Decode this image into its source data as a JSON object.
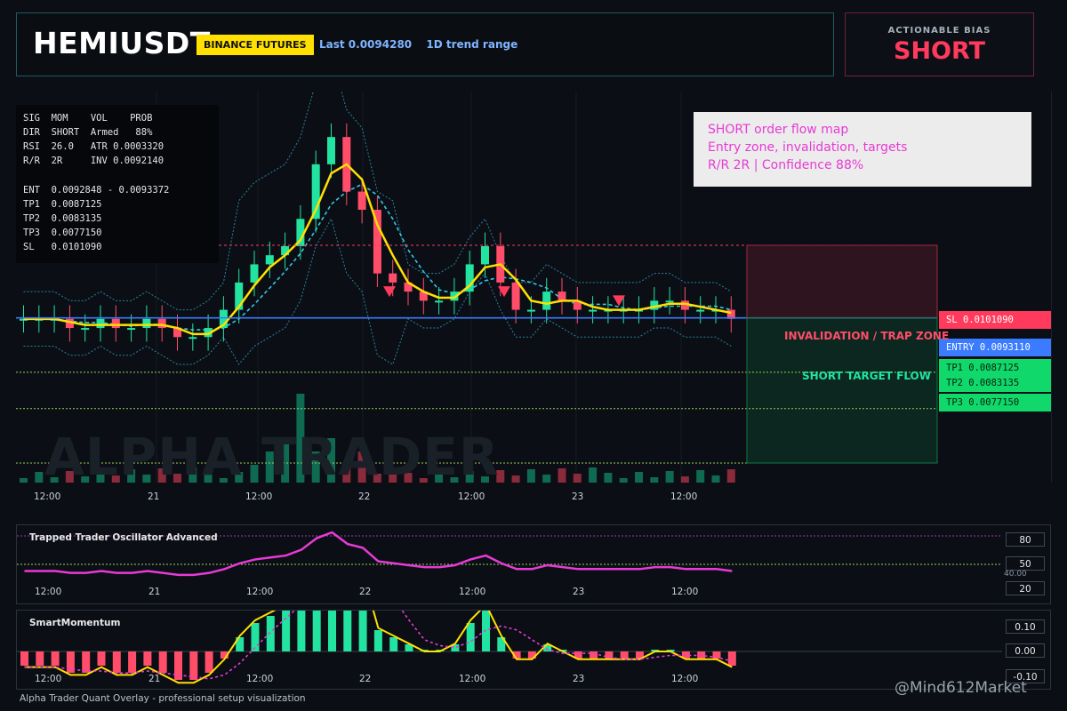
{
  "header": {
    "symbol": "HEMIUSDT",
    "exchange": "BINANCE FUTURES",
    "last_price": "Last 0.0094280",
    "range_label": "1D trend range"
  },
  "bias": {
    "label": "ACTIONABLE BIAS",
    "value": "SHORT",
    "color": "#ff3a5c"
  },
  "signal_table": {
    "rows": [
      "SIG  MOM    VOL    PROB",
      "DIR  SHORT  Armed   88%",
      "RSI  26.0   ATR 0.0003320",
      "R/R  2R     INV 0.0092140",
      "",
      "ENT  0.0092848 - 0.0093372",
      "TP1  0.0087125",
      "TP2  0.0083135",
      "TP3  0.0077150",
      "SL   0.0101090"
    ]
  },
  "info_box": {
    "line1": "SHORT order flow map",
    "line2": "Entry zone, invalidation, targets",
    "line3": "R/R 2R | Confidence 88%"
  },
  "watermark": "ALPHA TRADER",
  "levels": {
    "sl": "SL 0.0101090",
    "entry": "ENTRY 0.0093110",
    "tp1": "TP1 0.0087125",
    "tp2": "TP2 0.0083135",
    "tp3": "TP3 0.0077150",
    "invalidation_label": "INVALIDATION / TRAP ZONE",
    "target_label": "SHORT TARGET FLOW"
  },
  "time_axis": [
    "12:00",
    "21",
    "12:00",
    "22",
    "12:00",
    "23",
    "12:00"
  ],
  "oscillator": {
    "title": "Trapped Trader Oscillator Advanced",
    "scale": [
      "80",
      "50",
      "20"
    ],
    "extra_tick": "40.00"
  },
  "momentum": {
    "title": "SmartMomentum",
    "scale": [
      "0.10",
      "0.00",
      "-0.10"
    ]
  },
  "footer": "Alpha Trader Quant Overlay - professional setup visualization",
  "credit": "@Mind612Market",
  "colors": {
    "bull": "#22e3a0",
    "bear": "#ff4d6a",
    "ema": "#ffe000",
    "band": "#35c6e8",
    "magenta": "#e83ad6",
    "entry": "#3a7bff"
  },
  "chart_data": {
    "type": "candlestick",
    "series": [
      {
        "name": "price",
        "values": [
          0.0093,
          0.0093,
          0.0093,
          0.0092,
          0.0092,
          0.0093,
          0.0092,
          0.0092,
          0.0093,
          0.0092,
          0.0091,
          0.0091,
          0.0092,
          0.0094,
          0.0097,
          0.0099,
          0.01,
          0.0101,
          0.0104,
          0.011,
          0.0113,
          0.0107,
          0.0105,
          0.0098,
          0.0097,
          0.0096,
          0.0095,
          0.0095,
          0.0096,
          0.0099,
          0.0101,
          0.0097,
          0.0094,
          0.0094,
          0.0096,
          0.0095,
          0.0094,
          0.0094,
          0.0094,
          0.0094,
          0.0094,
          0.0095,
          0.0095,
          0.0094,
          0.0094,
          0.0094,
          0.0093
        ]
      }
    ]
  }
}
